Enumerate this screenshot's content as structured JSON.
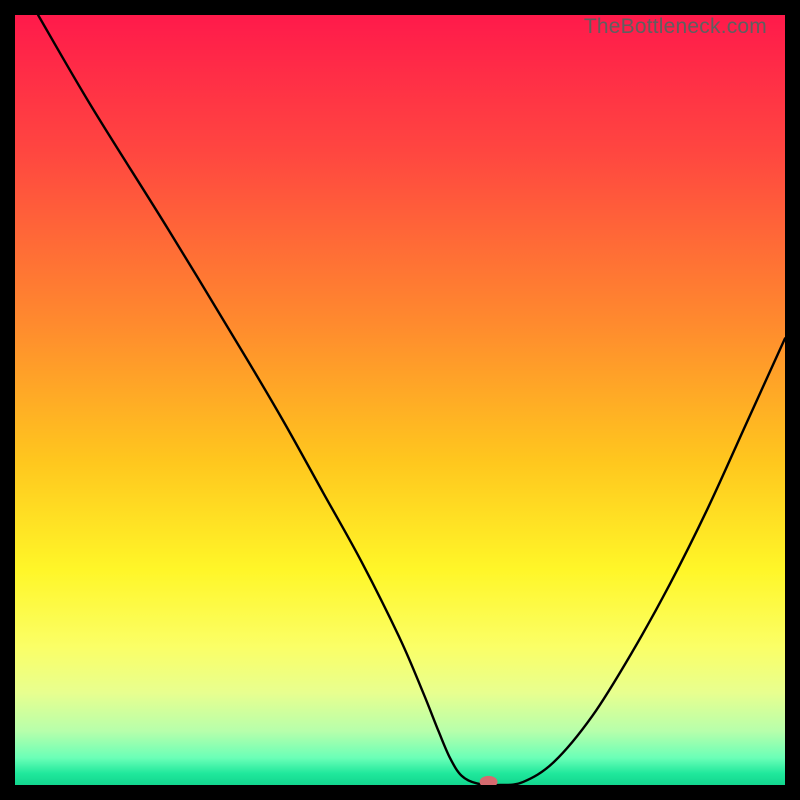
{
  "watermark": "TheBottleneck.com",
  "chart_data": {
    "type": "line",
    "title": "",
    "xlabel": "",
    "ylabel": "",
    "xlim": [
      0,
      100
    ],
    "ylim": [
      0,
      100
    ],
    "gradient_stops": [
      {
        "offset": 0.0,
        "color": "#ff1a4b"
      },
      {
        "offset": 0.18,
        "color": "#ff4740"
      },
      {
        "offset": 0.4,
        "color": "#ff8a2e"
      },
      {
        "offset": 0.58,
        "color": "#ffc71e"
      },
      {
        "offset": 0.72,
        "color": "#fff628"
      },
      {
        "offset": 0.82,
        "color": "#fbff66"
      },
      {
        "offset": 0.88,
        "color": "#e8ff8f"
      },
      {
        "offset": 0.93,
        "color": "#b7ffab"
      },
      {
        "offset": 0.965,
        "color": "#6affb7"
      },
      {
        "offset": 0.985,
        "color": "#20e89c"
      },
      {
        "offset": 1.0,
        "color": "#12d68e"
      }
    ],
    "series": [
      {
        "name": "bottleneck-curve",
        "x": [
          3.0,
          10.0,
          20.0,
          30.0,
          35.0,
          40.0,
          45.0,
          50.0,
          53.0,
          55.0,
          56.5,
          58.0,
          60.0,
          63.0,
          66.0,
          70.0,
          75.0,
          80.0,
          85.0,
          90.0,
          95.0,
          100.0
        ],
        "y": [
          100.0,
          88.0,
          72.0,
          55.5,
          47.0,
          38.0,
          29.0,
          19.0,
          12.0,
          7.0,
          3.5,
          1.2,
          0.2,
          0.0,
          0.4,
          3.0,
          9.0,
          17.0,
          26.0,
          36.0,
          47.0,
          58.0
        ]
      }
    ],
    "marker": {
      "x": 61.5,
      "y": 0.4,
      "rx": 9,
      "ry": 6,
      "fill": "#d46a6f"
    }
  }
}
